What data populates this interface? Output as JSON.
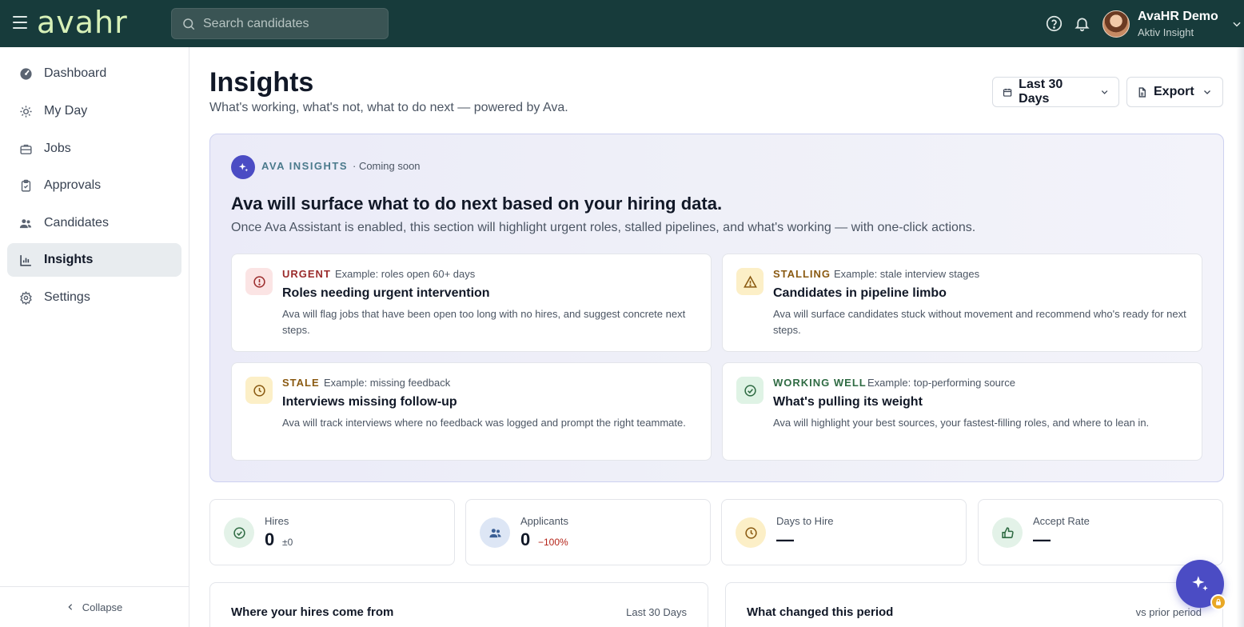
{
  "app": {
    "logo": "avahr"
  },
  "topbar": {
    "search_placeholder": "Search candidates",
    "user_name": "AvaHR Demo",
    "user_org": "Aktiv Insight"
  },
  "sidebar": {
    "items": [
      {
        "label": "Dashboard",
        "icon": "dashboard-icon"
      },
      {
        "label": "My Day",
        "icon": "sun-icon"
      },
      {
        "label": "Jobs",
        "icon": "briefcase-icon"
      },
      {
        "label": "Approvals",
        "icon": "clipboard-icon"
      },
      {
        "label": "Candidates",
        "icon": "people-icon"
      },
      {
        "label": "Insights",
        "icon": "chart-icon",
        "active": true
      },
      {
        "label": "Settings",
        "icon": "gear-icon"
      }
    ],
    "collapse_label": "Collapse"
  },
  "header": {
    "title": "Insights",
    "subtitle": "What's working, what's not, what to do next — powered by Ava.",
    "date_range_label": "Last 30 Days",
    "export_label": "Export"
  },
  "ava": {
    "label": "AVA INSIGHTS",
    "status": "· Coming soon",
    "heading": "Ava will surface what to do next based on your hiring data.",
    "description": "Once Ava Assistant is enabled, this section will highlight urgent roles, stalled pipelines, and what's working — with one-click actions.",
    "cards": [
      {
        "tag": "URGENT",
        "example": "Example: roles open 60+ days",
        "title": "Roles needing urgent intervention",
        "desc": "Ava will flag jobs that have been open too long with no hires, and suggest concrete next steps.",
        "color": "#9b2c2c"
      },
      {
        "tag": "STALLING",
        "example": "Example: stale interview stages",
        "title": "Candidates in pipeline limbo",
        "desc": "Ava will surface candidates stuck without movement and recommend who's ready for next steps.",
        "color": "#8a5a12"
      },
      {
        "tag": "STALE",
        "example": "Example: missing feedback",
        "title": "Interviews missing follow-up",
        "desc": "Ava will track interviews where no feedback was logged and prompt the right teammate.",
        "color": "#8a5a12"
      },
      {
        "tag": "WORKING WELL",
        "example": "Example: top-performing source",
        "title": "What's pulling its weight",
        "desc": "Ava will highlight your best sources, your fastest-filling roles, and where to lean in.",
        "color": "#2f6b43"
      }
    ]
  },
  "kpis": [
    {
      "label": "Hires",
      "value": "0",
      "delta": "±0",
      "delta_color": "#4b5563"
    },
    {
      "label": "Applicants",
      "value": "0",
      "delta": "−100%",
      "delta_color": "#b42318"
    },
    {
      "label": "Days to Hire",
      "value": "—",
      "delta": ""
    },
    {
      "label": "Accept Rate",
      "value": "—",
      "delta": ""
    }
  ],
  "sections": [
    {
      "title": "Where your hires come from",
      "right": "Last 30 Days"
    },
    {
      "title": "What changed this period",
      "right": "vs prior period"
    }
  ],
  "colors": {
    "topbar": "#173b3b",
    "accent": "#4b4cc4",
    "logo": "#d8f1b8"
  }
}
